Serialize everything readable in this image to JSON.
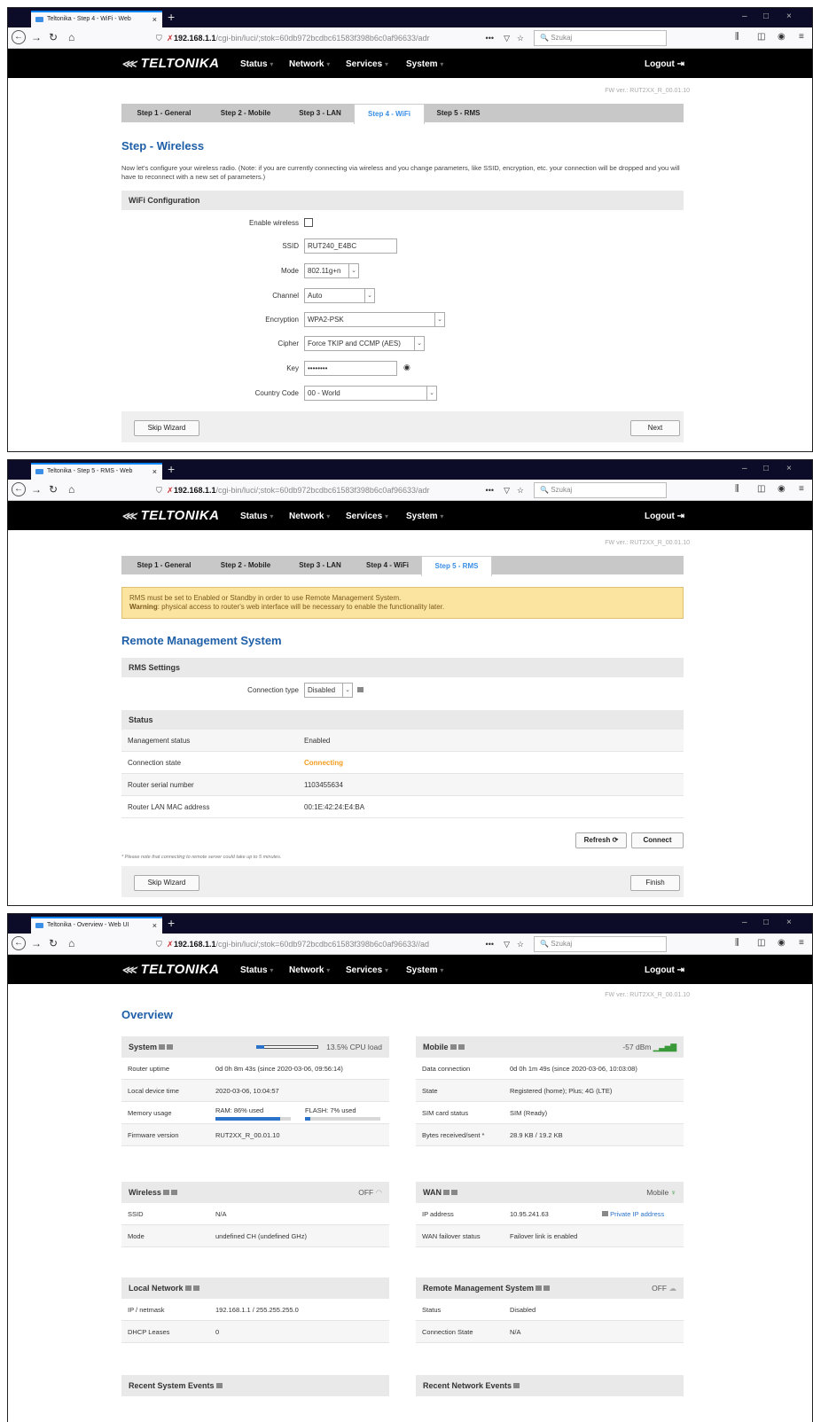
{
  "browser": {
    "win_controls": [
      "–",
      "□",
      "×"
    ],
    "address_prefix": "192.168.1.1",
    "address_dots": "•••",
    "search_placeholder": "Szukaj"
  },
  "screens": [
    {
      "tab_title": "Teltonika - Step 4 - WiFi - Web",
      "address_rest": "/cgi-bin/luci/;stok=60db972bcdbc61583f398b6c0af96633/adr"
    },
    {
      "tab_title": "Teltonika - Step 5 - RMS - Web",
      "address_rest": "/cgi-bin/luci/;stok=60db972bcdbc61583f398b6c0af96633/adr"
    },
    {
      "tab_title": "Teltonika - Overview - Web UI",
      "address_rest": "/cgi-bin/luci/;stok=60db972bcdbc61583f398b6c0af96633//ad"
    }
  ],
  "app": {
    "logo": "TELTONIKA",
    "menu": [
      "Status",
      "Network",
      "Services",
      "System"
    ],
    "logout": "Logout",
    "fw": "FW ver.: RUT2XX_R_00.01.10"
  },
  "steps": [
    "Step 1 - General",
    "Step 2 - Mobile",
    "Step 3 - LAN",
    "Step 4 - WiFi",
    "Step 5 - RMS"
  ],
  "wifi": {
    "title": "Step - Wireless",
    "note": "Now let's configure your wireless radio. (Note: if you are currently connecting via wireless and you change parameters, like SSID, encryption, etc. your connection will be dropped and you will have to reconnect with a new set of parameters.)",
    "panel": "WiFi Configuration",
    "enable_label": "Enable wireless",
    "ssid_label": "SSID",
    "ssid": "RUT240_E4BC",
    "mode_label": "Mode",
    "mode": "802.11g+n",
    "channel_label": "Channel",
    "channel": "Auto",
    "enc_label": "Encryption",
    "enc": "WPA2-PSK",
    "cipher_label": "Cipher",
    "cipher": "Force TKIP and CCMP (AES)",
    "key_label": "Key",
    "key": "••••••••",
    "cc_label": "Country Code",
    "cc": "00 - World",
    "skip": "Skip Wizard",
    "next": "Next"
  },
  "rms": {
    "warn1": "RMS must be set to Enabled or Standby in order to use Remote Management System.",
    "warn_bold": "Warning",
    "warn2": ": physical access to router's web interface will be necessary to enable the functionality later.",
    "title": "Remote Management System",
    "panel": "RMS Settings",
    "conn_label": "Connection type",
    "conn": "Disabled",
    "status_panel": "Status",
    "rows": [
      {
        "k": "Management status",
        "v": "Enabled"
      },
      {
        "k": "Connection state",
        "v": "Connecting"
      },
      {
        "k": "Router serial number",
        "v": "1103455634"
      },
      {
        "k": "Router LAN MAC address",
        "v": "00:1E:42:24:E4:BA"
      }
    ],
    "refresh": "Refresh",
    "connect": "Connect",
    "small": "* Please note that connecting to remote server could take up to 5 minutes.",
    "skip": "Skip Wizard",
    "finish": "Finish"
  },
  "overview": {
    "title": "Overview",
    "system": {
      "title": "System",
      "cpu": "13.5% CPU load",
      "cpu_fraction": 0.135,
      "rows": [
        {
          "k": "Router uptime",
          "v": "0d 0h 8m 43s (since 2020-03-06, 09:56:14)"
        },
        {
          "k": "Local device time",
          "v": "2020-03-06, 10:04:57"
        },
        {
          "k": "Memory usage",
          "ram": "RAM: 86% used",
          "flash": "FLASH: 7% used"
        },
        {
          "k": "Firmware version",
          "v": "RUT2XX_R_00.01.10"
        }
      ],
      "ram_fraction": 0.86,
      "flash_fraction": 0.07
    },
    "mobile": {
      "title": "Mobile",
      "signal": "-57 dBm",
      "rows": [
        {
          "k": "Data connection",
          "v": "0d 0h 1m 49s (since 2020-03-06, 10:03:08)"
        },
        {
          "k": "State",
          "v": "Registered (home); Plus; 4G (LTE)"
        },
        {
          "k": "SIM card status",
          "v": "SIM (Ready)"
        },
        {
          "k": "Bytes received/sent *",
          "v": "28.9 KB / 19.2 KB"
        }
      ]
    },
    "wireless": {
      "title": "Wireless",
      "state": "OFF",
      "rows": [
        {
          "k": "SSID",
          "v": "N/A"
        },
        {
          "k": "Mode",
          "v": "undefined CH (undefined GHz)"
        }
      ]
    },
    "wan": {
      "title": "WAN",
      "state": "Mobile",
      "rows": [
        {
          "k": "IP address",
          "v": "10.95.241.63",
          "extra": "Private IP address"
        },
        {
          "k": "WAN failover status",
          "v": "Failover link is enabled"
        }
      ]
    },
    "lan": {
      "title": "Local Network",
      "rows": [
        {
          "k": "IP / netmask",
          "v": "192.168.1.1 / 255.255.255.0"
        },
        {
          "k": "DHCP Leases",
          "v": "0"
        }
      ]
    },
    "rms": {
      "title": "Remote Management System",
      "state": "OFF",
      "rows": [
        {
          "k": "Status",
          "v": "Disabled"
        },
        {
          "k": "Connection State",
          "v": "N/A"
        }
      ]
    },
    "sys_events": "Recent System Events",
    "net_events": "Recent Network Events"
  }
}
